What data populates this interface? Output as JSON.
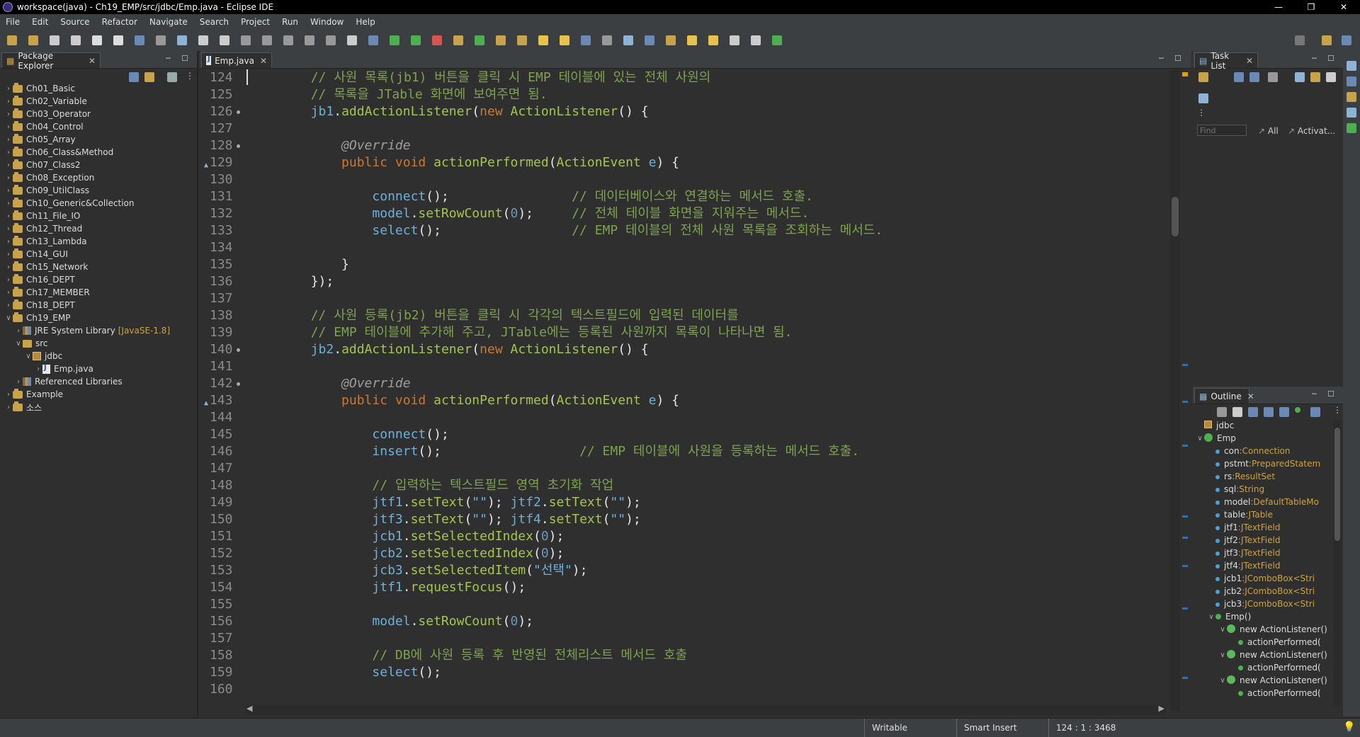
{
  "window": {
    "title": "workspace(java) - Ch19_EMP/src/jdbc/Emp.java - Eclipse IDE"
  },
  "menu": [
    "File",
    "Edit",
    "Source",
    "Refactor",
    "Navigate",
    "Search",
    "Project",
    "Run",
    "Window",
    "Help"
  ],
  "package_explorer": {
    "tab_label": "Package Explorer",
    "projects": [
      "Ch01_Basic",
      "Ch02_Variable",
      "Ch03_Operator",
      "Ch04_Control",
      "Ch05_Array",
      "Ch06_Class&Method",
      "Ch07_Class2",
      "Ch08_Exception",
      "Ch09_UtilClass",
      "Ch10_Generic&Collection",
      "Ch11_File_IO",
      "Ch12_Thread",
      "Ch13_Lambda",
      "Ch14_GUI",
      "Ch15_Network",
      "Ch16_DEPT",
      "Ch17_MEMBER",
      "Ch18_DEPT",
      "Ch19_EMP"
    ],
    "jre_label": "JRE System Library",
    "jre_version": "[JavaSE-1.8]",
    "src_label": "src",
    "pkg_label": "jdbc",
    "file_label": "Emp.java",
    "reflib_label": "Referenced Libraries",
    "after_projects": [
      "Example",
      "소스"
    ]
  },
  "editor": {
    "tab_label": "Emp.java",
    "lines": [
      {
        "n": "124",
        "t": "        // 사원 목록(jb1) 버튼을 클릭 시 EMP 테이블에 있는 전체 사원의",
        "k": "cmt"
      },
      {
        "n": "125",
        "t": "        // 목록을 JTable 화면에 보여주면 됨.",
        "k": "cmt"
      },
      {
        "n": "126",
        "t": "        jb1.addActionListener(new ActionListener() {",
        "k": "listener"
      },
      {
        "n": "127",
        "t": "",
        "k": "blank"
      },
      {
        "n": "128",
        "t": "            @Override",
        "k": "ann"
      },
      {
        "n": "129",
        "t": "            public void actionPerformed(ActionEvent e) {",
        "k": "method"
      },
      {
        "n": "130",
        "t": "",
        "k": "blank"
      },
      {
        "n": "131",
        "t": "                connect();                // 데이터베이스와 연결하는 메서드 호출.",
        "k": "call_cmt"
      },
      {
        "n": "132",
        "t": "                model.setRowCount(0);     // 전체 테이블 화면을 지워주는 메서드.",
        "k": "call_cmt"
      },
      {
        "n": "133",
        "t": "                select();                 // EMP 테이블의 전체 사원 목록을 조회하는 메서드.",
        "k": "call_cmt"
      },
      {
        "n": "134",
        "t": "",
        "k": "blank"
      },
      {
        "n": "135",
        "t": "            }",
        "k": "plain"
      },
      {
        "n": "136",
        "t": "        });",
        "k": "plain"
      },
      {
        "n": "137",
        "t": "",
        "k": "blank"
      },
      {
        "n": "138",
        "t": "        // 사원 등록(jb2) 버튼을 클릭 시 각각의 텍스트필드에 입력된 데이터를",
        "k": "cmt"
      },
      {
        "n": "139",
        "t": "        // EMP 테이블에 추가해 주고, JTable에는 등록된 사원까지 목록이 나타나면 됨.",
        "k": "cmt"
      },
      {
        "n": "140",
        "t": "        jb2.addActionListener(new ActionListener() {",
        "k": "listener"
      },
      {
        "n": "141",
        "t": "",
        "k": "blank"
      },
      {
        "n": "142",
        "t": "            @Override",
        "k": "ann"
      },
      {
        "n": "143",
        "t": "            public void actionPerformed(ActionEvent e) {",
        "k": "method"
      },
      {
        "n": "144",
        "t": "",
        "k": "blank"
      },
      {
        "n": "145",
        "t": "                connect();",
        "k": "call"
      },
      {
        "n": "146",
        "t": "                insert();                  // EMP 테이블에 사원을 등록하는 메서드 호출.",
        "k": "call_cmt"
      },
      {
        "n": "147",
        "t": "",
        "k": "blank"
      },
      {
        "n": "148",
        "t": "                // 입력하는 텍스트필드 영역 초기화 작업",
        "k": "cmt"
      },
      {
        "n": "149",
        "t": "                jtf1.setText(\"\"); jtf2.setText(\"\");",
        "k": "call"
      },
      {
        "n": "150",
        "t": "                jtf3.setText(\"\"); jtf4.setText(\"\");",
        "k": "call"
      },
      {
        "n": "151",
        "t": "                jcb1.setSelectedIndex(0);",
        "k": "call"
      },
      {
        "n": "152",
        "t": "                jcb2.setSelectedIndex(0);",
        "k": "call"
      },
      {
        "n": "153",
        "t": "                jcb3.setSelectedItem(\"선택\");",
        "k": "call"
      },
      {
        "n": "154",
        "t": "                jtf1.requestFocus();",
        "k": "call"
      },
      {
        "n": "155",
        "t": "",
        "k": "blank"
      },
      {
        "n": "156",
        "t": "                model.setRowCount(0);",
        "k": "call"
      },
      {
        "n": "157",
        "t": "",
        "k": "blank"
      },
      {
        "n": "158",
        "t": "                // DB에 사원 등록 후 반영된 전체리스트 메서드 호출",
        "k": "cmt"
      },
      {
        "n": "159",
        "t": "                select();",
        "k": "call"
      },
      {
        "n": "160",
        "t": "",
        "k": "blank"
      }
    ]
  },
  "tasklist": {
    "tab_label": "Task List",
    "find_placeholder": "Find",
    "all_label": "All",
    "activate_label": "Activat..."
  },
  "outline": {
    "tab_label": "Outline",
    "package": "jdbc",
    "class": "Emp",
    "fields": [
      {
        "name": "con",
        "type": "Connection"
      },
      {
        "name": "pstmt",
        "type": "PreparedStatem"
      },
      {
        "name": "rs",
        "type": "ResultSet"
      },
      {
        "name": "sql",
        "type": "String"
      },
      {
        "name": "model",
        "type": "DefaultTableMo"
      },
      {
        "name": "table",
        "type": "JTable"
      },
      {
        "name": "jtf1",
        "type": "JTextField"
      },
      {
        "name": "jtf2",
        "type": "JTextField"
      },
      {
        "name": "jtf3",
        "type": "JTextField"
      },
      {
        "name": "jtf4",
        "type": "JTextField"
      },
      {
        "name": "jcb1",
        "type": "JComboBox<Stri"
      },
      {
        "name": "jcb2",
        "type": "JComboBox<Stri"
      },
      {
        "name": "jcb3",
        "type": "JComboBox<Stri"
      }
    ],
    "constructor": "Emp()",
    "listener_label": "new ActionListener()",
    "method_label": "actionPerformed("
  },
  "status": {
    "writable": "Writable",
    "insert_mode": "Smart Insert",
    "position": "124 : 1 : 3468"
  },
  "colors": {
    "background": "#2f2f2f",
    "comment": "#7fa24f",
    "keyword": "#cc7832",
    "method": "#a7c44f"
  }
}
